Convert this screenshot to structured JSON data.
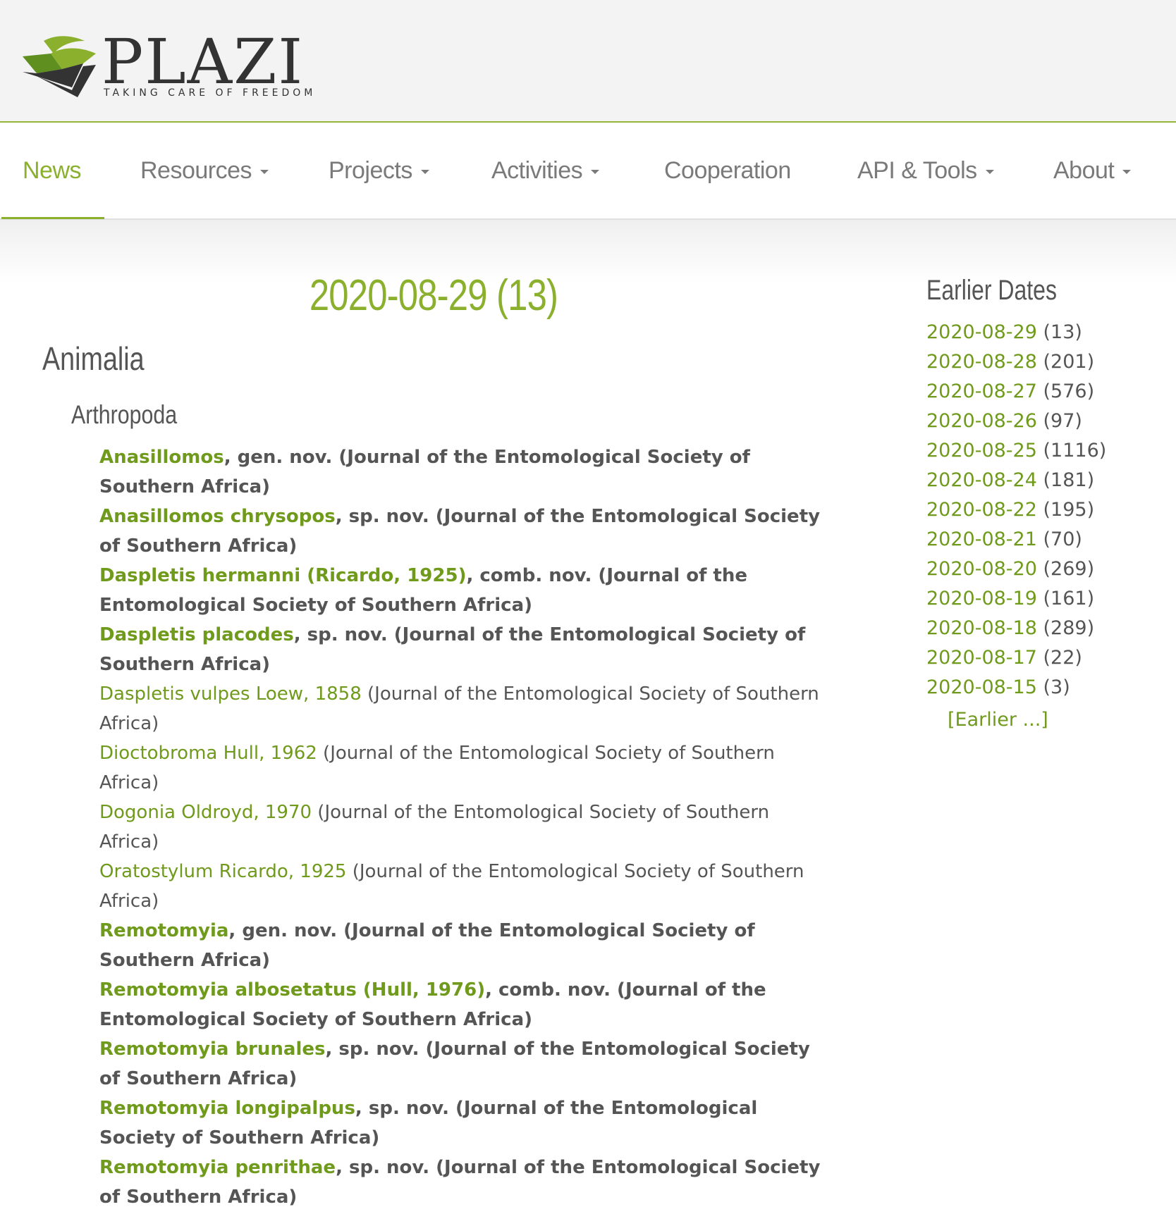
{
  "brand": {
    "name": "PLAZI",
    "tagline": "TAKING CARE OF FREEDOM"
  },
  "nav": {
    "items": [
      {
        "label": "News",
        "dropdown": false,
        "active": true
      },
      {
        "label": "Resources",
        "dropdown": true
      },
      {
        "label": "Projects",
        "dropdown": true
      },
      {
        "label": "Activities",
        "dropdown": true
      },
      {
        "label": "Cooperation",
        "dropdown": false
      },
      {
        "label": "API & Tools",
        "dropdown": true
      },
      {
        "label": "About",
        "dropdown": true
      }
    ]
  },
  "main": {
    "date_heading": "2020-08-29 (13)",
    "kingdom": "Animalia",
    "phylum": "Arthropoda",
    "records": [
      {
        "name": "Anasillomos",
        "rest": ", gen. nov. (Journal of the Entomological Society of Southern Africa)",
        "new": true
      },
      {
        "name": "Anasillomos chrysopos",
        "rest": ", sp. nov. (Journal of the Entomological Society of Southern Africa)",
        "new": true
      },
      {
        "name": "Daspletis hermanni (Ricardo, 1925)",
        "rest": ", comb. nov. (Journal of the Entomological Society of Southern Africa)",
        "new": true
      },
      {
        "name": "Daspletis placodes",
        "rest": ", sp. nov. (Journal of the Entomological Society of Southern Africa)",
        "new": true
      },
      {
        "name": "Daspletis vulpes Loew, 1858",
        "rest": " (Journal of the Entomological Society of Southern Africa)",
        "new": false
      },
      {
        "name": "Dioctobroma Hull, 1962",
        "rest": " (Journal of the Entomological Society of Southern Africa)",
        "new": false
      },
      {
        "name": "Dogonia Oldroyd, 1970",
        "rest": " (Journal of the Entomological Society of Southern Africa)",
        "new": false
      },
      {
        "name": "Oratostylum Ricardo, 1925",
        "rest": " (Journal of the Entomological Society of Southern Africa)",
        "new": false
      },
      {
        "name": "Remotomyia",
        "rest": ", gen. nov. (Journal of the Entomological Society of Southern Africa)",
        "new": true
      },
      {
        "name": "Remotomyia albosetatus (Hull, 1976)",
        "rest": ", comb. nov. (Journal of the Entomological Society of Southern Africa)",
        "new": true
      },
      {
        "name": "Remotomyia brunales",
        "rest": ", sp. nov. (Journal of the Entomological Society of Southern Africa)",
        "new": true
      },
      {
        "name": "Remotomyia longipalpus",
        "rest": ", sp. nov. (Journal of the Entomological Society of Southern Africa)",
        "new": true
      },
      {
        "name": "Remotomyia penrithae",
        "rest": ", sp. nov. (Journal of the Entomological Society of Southern Africa)",
        "new": true
      }
    ]
  },
  "sidebar": {
    "title": "Earlier Dates",
    "dates": [
      {
        "date": "2020-08-29",
        "count": "(13)"
      },
      {
        "date": "2020-08-28",
        "count": "(201)"
      },
      {
        "date": "2020-08-27",
        "count": "(576)"
      },
      {
        "date": "2020-08-26",
        "count": "(97)"
      },
      {
        "date": "2020-08-25",
        "count": "(1116)"
      },
      {
        "date": "2020-08-24",
        "count": "(181)"
      },
      {
        "date": "2020-08-22",
        "count": "(195)"
      },
      {
        "date": "2020-08-21",
        "count": "(70)"
      },
      {
        "date": "2020-08-20",
        "count": "(269)"
      },
      {
        "date": "2020-08-19",
        "count": "(161)"
      },
      {
        "date": "2020-08-18",
        "count": "(289)"
      },
      {
        "date": "2020-08-17",
        "count": "(22)"
      },
      {
        "date": "2020-08-15",
        "count": "(3)"
      }
    ],
    "earlier_label": "[Earlier ...]"
  },
  "colors": {
    "accent": "#8ab02e",
    "link": "#6f9a1c",
    "text": "#555555",
    "header_bg": "#f3f3f3"
  }
}
